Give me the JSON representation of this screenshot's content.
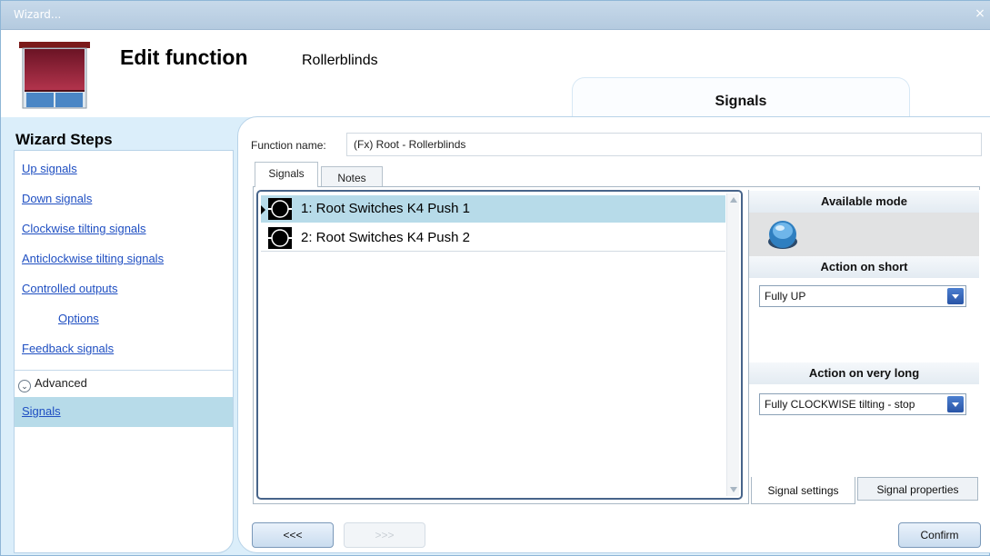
{
  "window": {
    "title": "Wizard...",
    "close_glyph": "×"
  },
  "header": {
    "title": "Edit function",
    "subtitle": "Rollerblinds",
    "tab_label": "Signals"
  },
  "wizard": {
    "title": "Wizard Steps",
    "steps": [
      "Up signals",
      "Down signals",
      "Clockwise tilting signals",
      "Anticlockwise tilting signals",
      "Controlled outputs",
      "Options",
      "Feedback signals"
    ],
    "advanced_label": "Advanced",
    "selected_step": "Signals"
  },
  "function": {
    "name_label": "Function name:",
    "name_value": "(Fx) Root - Rollerblinds"
  },
  "tabs": {
    "signals": "Signals",
    "notes": "Notes"
  },
  "signals_list": [
    {
      "label": "1: Root Switches K4 Push 1",
      "selected": true
    },
    {
      "label": "2: Root Switches K4 Push 2",
      "selected": false
    }
  ],
  "right_panel": {
    "available_mode_label": "Available mode",
    "mode_icon": "push-button-icon",
    "action_short_label": "Action on short",
    "action_short_value": "Fully UP",
    "action_very_long_label": "Action on very long",
    "action_very_long_value": "Fully CLOCKWISE tilting - stop"
  },
  "bottom_tabs": {
    "settings": "Signal settings",
    "properties": "Signal properties"
  },
  "buttons": {
    "prev": "<<<",
    "next": ">>>",
    "confirm": "Confirm"
  },
  "colors": {
    "selection": "#b7dbe9",
    "link": "#1f4fc2",
    "dropdown_arrow": "#2854a6"
  }
}
